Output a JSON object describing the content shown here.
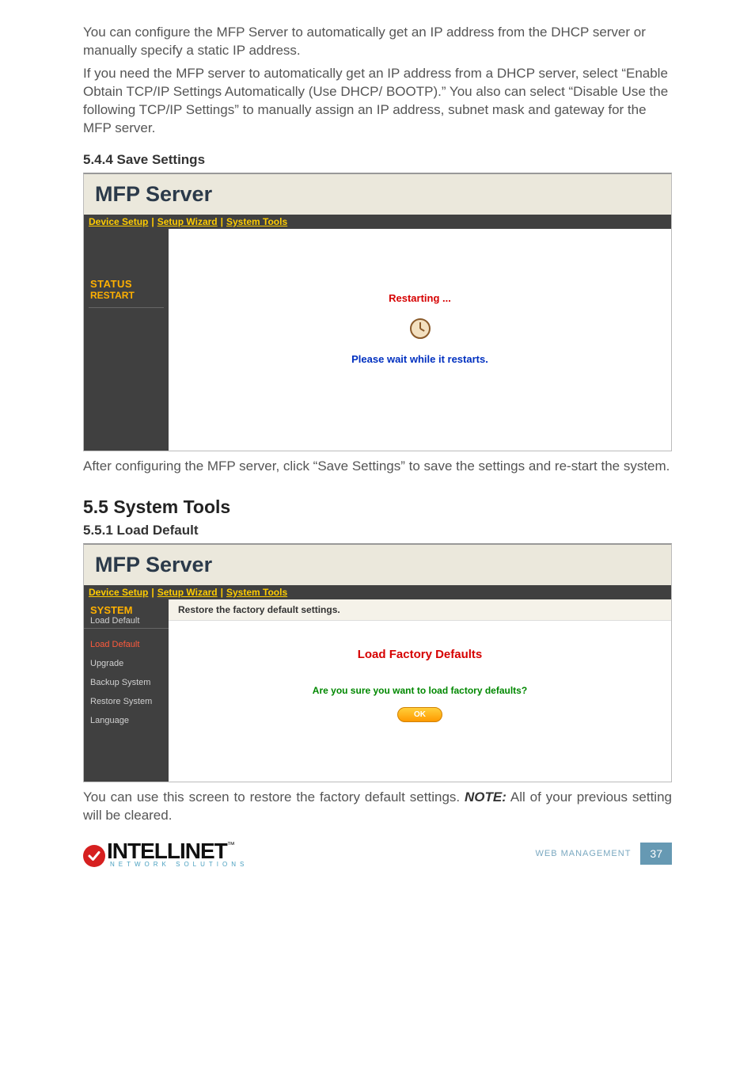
{
  "intro_para1": "You can configure the MFP Server to automatically get an IP address from the DHCP server or manually specify a static IP address.",
  "intro_para2": "If you need the MFP server to automatically get an IP address from a DHCP server, select “Enable Obtain TCP/IP Settings Automatically (Use DHCP/ BOOTP).” You also can select “Disable Use the following TCP/IP Settings” to manually assign an IP address, subnet mask and gateway for the MFP server.",
  "h544": "5.4.4  Save Settings",
  "panel1": {
    "title": "MFP Server",
    "nav": {
      "a": "Device Setup",
      "b": "Setup Wizard",
      "c": "System Tools"
    },
    "sidebar": {
      "line1": "STATUS",
      "line2": "RESTART"
    },
    "restarting": "Restarting ...",
    "please_wait": "Please wait while it restarts."
  },
  "after_panel1": "After configuring the MFP server, click “Save Settings” to save the settings and re-start the system.",
  "h55": "5.5  System Tools",
  "h551": "5.5.1  Load Default",
  "panel2": {
    "title": "MFP Server",
    "nav": {
      "a": "Device Setup",
      "b": "Setup Wizard",
      "c": "System Tools"
    },
    "sidebar": {
      "title": "SYSTEM",
      "subtitle": "Load Default",
      "links": [
        "Load Default",
        "Upgrade",
        "Backup System",
        "Restore System",
        "Language"
      ]
    },
    "caption": "Restore the factory default settings.",
    "heading": "Load Factory Defaults",
    "question": "Are you sure you want to load factory defaults?",
    "ok": "OK"
  },
  "note_pre": "You can use this screen to restore the factory default settings. ",
  "note_bold": "NOTE:",
  "note_post": " All of your previous setting will be cleared.",
  "footer": {
    "brand": "INTELLINET",
    "tag": "NETWORK SOLUTIONS",
    "section": "WEB MANAGEMENT",
    "page": "37"
  }
}
